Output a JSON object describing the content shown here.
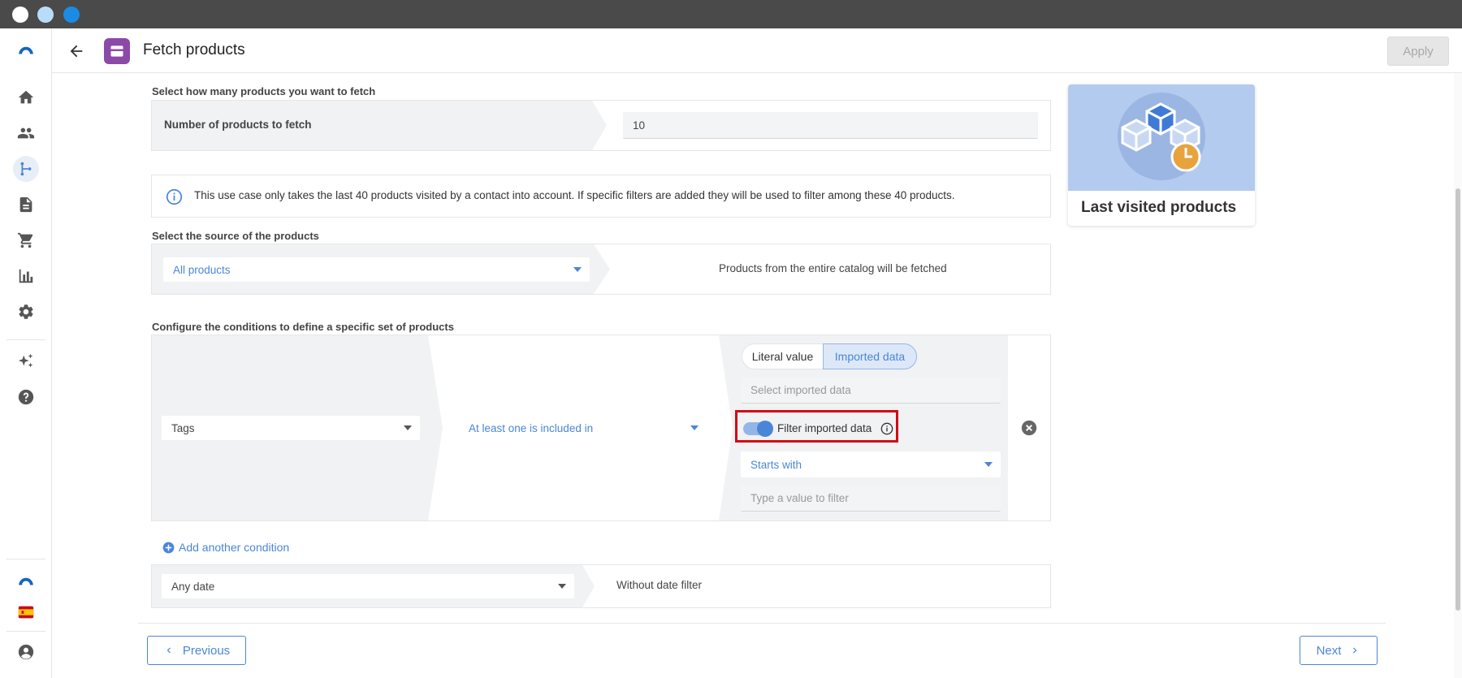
{
  "window": {
    "dots": [
      {
        "name": "close",
        "color": "#ffffff"
      },
      {
        "name": "minimize",
        "color": "#b9dcfb"
      },
      {
        "name": "maximize",
        "color": "#1a8ce5"
      }
    ]
  },
  "header": {
    "title": "Fetch products",
    "apply_label": "Apply"
  },
  "sidebar": {
    "items": [
      {
        "name": "home",
        "icon": "home-icon"
      },
      {
        "name": "contacts",
        "icon": "people-icon"
      },
      {
        "name": "flows",
        "icon": "branch-icon",
        "active": true
      },
      {
        "name": "documents",
        "icon": "document-icon"
      },
      {
        "name": "shop",
        "icon": "cart-icon"
      },
      {
        "name": "reports",
        "icon": "bar-chart-icon"
      },
      {
        "name": "settings",
        "icon": "gear-icon"
      },
      {
        "name": "ai",
        "icon": "sparkles-icon"
      },
      {
        "name": "help",
        "icon": "help-icon"
      }
    ]
  },
  "fetch": {
    "label": "Select how many products you want to fetch",
    "field_label": "Number of products to fetch",
    "value": "10"
  },
  "info": {
    "text": "This use case only takes the last 40 products visited by a contact into account. If specific filters are added they will be used to filter among these 40 products."
  },
  "source": {
    "label": "Select the source of the products",
    "selected": "All products",
    "description": "Products from the entire catalog will be fetched"
  },
  "conditions": {
    "label": "Configure the conditions to define a specific set of products",
    "field": "Tags",
    "operator": "At least one is included in",
    "tabs": {
      "literal": "Literal value",
      "imported": "Imported data"
    },
    "imported_placeholder": "Select imported data",
    "filter_toggle_label": "Filter imported data",
    "filter_toggle_on": true,
    "filter_operator": "Starts with",
    "filter_value_placeholder": "Type a value to filter",
    "add_label": "Add another condition"
  },
  "date": {
    "selected": "Any date",
    "description": "Without date filter"
  },
  "card": {
    "title": "Last visited products"
  },
  "footer": {
    "previous": "Previous",
    "next": "Next"
  },
  "colors": {
    "accent": "#4a86d8",
    "module": "#8c4aa8",
    "highlight": "#d10a14"
  }
}
